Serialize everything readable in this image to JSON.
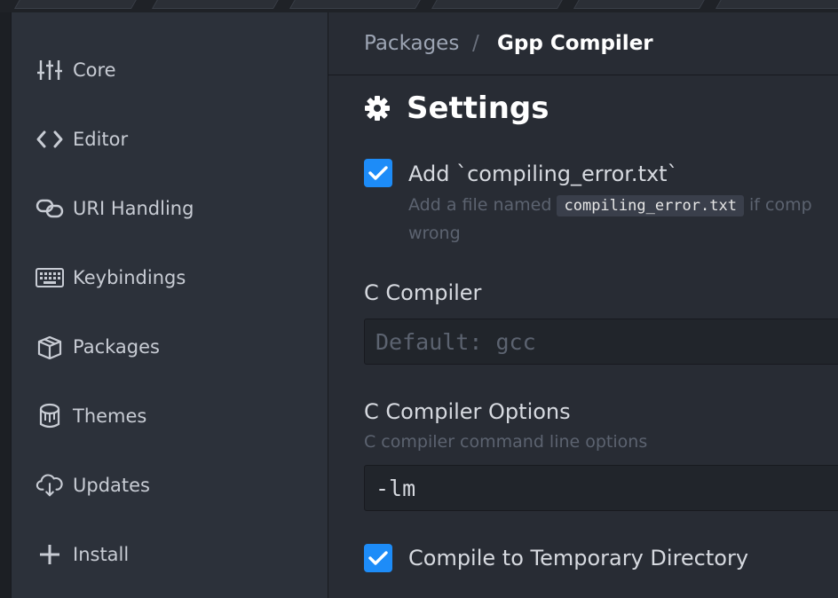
{
  "sidebar": {
    "items": [
      {
        "label": "Core",
        "icon": "settings-sliders-icon"
      },
      {
        "label": "Editor",
        "icon": "code-icon"
      },
      {
        "label": "URI Handling",
        "icon": "link-icon"
      },
      {
        "label": "Keybindings",
        "icon": "keyboard-icon"
      },
      {
        "label": "Packages",
        "icon": "package-icon"
      },
      {
        "label": "Themes",
        "icon": "paintcan-icon"
      },
      {
        "label": "Updates",
        "icon": "cloud-download-icon"
      },
      {
        "label": "Install",
        "icon": "plus-icon"
      }
    ]
  },
  "breadcrumb": {
    "root": "Packages",
    "separator": "/",
    "current": "Gpp Compiler"
  },
  "settings": {
    "title": "Settings",
    "add_error_file": {
      "checked": true,
      "label": "Add `compiling_error.txt`",
      "desc_prefix": "Add a file named",
      "desc_code": "compiling_error.txt",
      "desc_suffix": "if comp",
      "desc_line2": "wrong"
    },
    "c_compiler": {
      "label": "C Compiler",
      "value": "",
      "placeholder": "Default: gcc"
    },
    "c_compiler_options": {
      "label": "C Compiler Options",
      "description": "C compiler command line options",
      "value": "-lm"
    },
    "compile_to_temp": {
      "checked": true,
      "label": "Compile to Temporary Directory"
    }
  },
  "colors": {
    "accent": "#1d8cf8",
    "background": "#282c34",
    "sidebar": "#2c313a"
  }
}
